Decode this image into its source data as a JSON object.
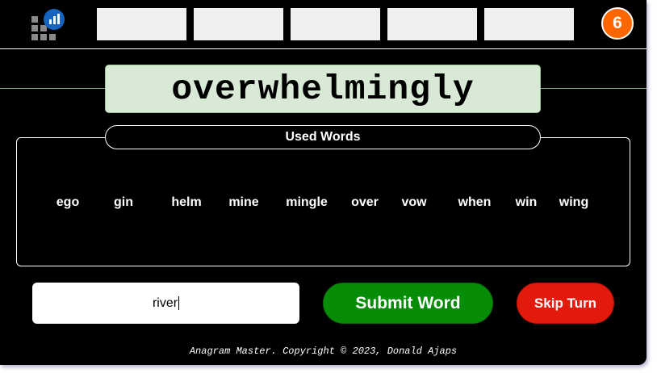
{
  "header": {
    "logo_icon": "bar-chart-grid-icon",
    "slots": [
      "",
      "",
      "",
      "",
      ""
    ],
    "score": "6"
  },
  "current_word": "overwhelmingly",
  "used_words": {
    "title": "Used Words",
    "items": [
      "ego",
      "gin",
      "helm",
      "mine",
      "mingle",
      "over",
      "vow",
      "when",
      "win",
      "wing"
    ]
  },
  "input": {
    "value": "river"
  },
  "buttons": {
    "submit_label": "Submit Word",
    "skip_label": "Skip Turn"
  },
  "footer": {
    "text": "Anagram Master. Copyright © 2023, Donald Ajaps"
  },
  "colors": {
    "background": "#000000",
    "word_box": "#d8ead6",
    "score_badge": "#ff6600",
    "submit": "#068c06",
    "skip": "#e11a0c",
    "logo_blue": "#1565c0"
  }
}
